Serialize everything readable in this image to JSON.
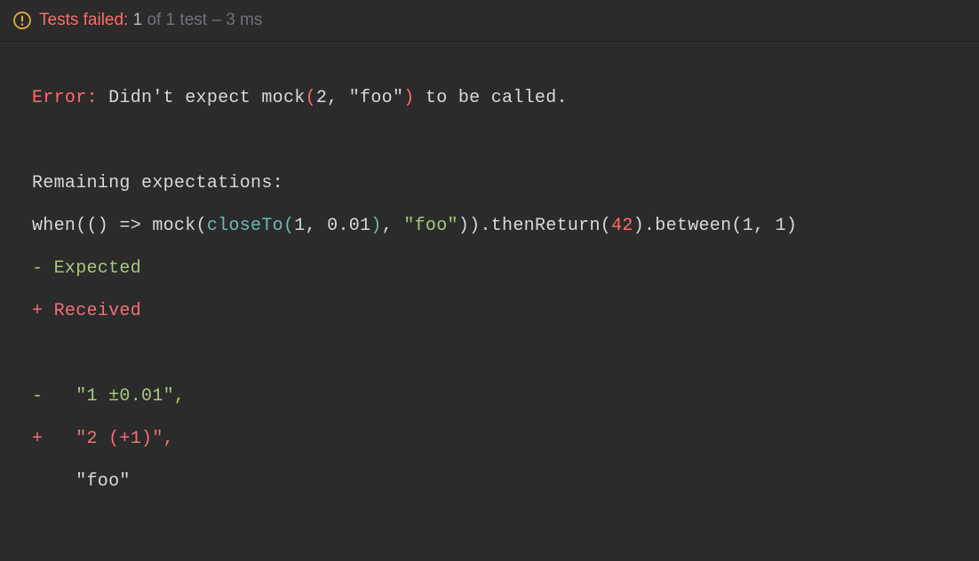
{
  "header": {
    "tests_failed_label": "Tests failed:",
    "failed_count": "1",
    "of_text": " of 1 test",
    "dash": " – ",
    "duration": "3 ms"
  },
  "output": {
    "error_label": "Error:",
    "error_prefix": " Didn't expect mock",
    "error_paren_open": "(",
    "error_args": "2, \"foo\"",
    "error_paren_close": ")",
    "error_suffix": " to be called.",
    "remaining_label": "Remaining expectations:",
    "when_text": "when(() => mock(",
    "closeTo_fn": "closeTo",
    "closeTo_open": "(",
    "closeTo_args": "1, 0.01",
    "closeTo_close": ")",
    "comma_foo": ", ",
    "foo_str": "\"foo\"",
    "after_mock_close": ")).thenReturn(",
    "return_val": "42",
    "after_return": ").between(",
    "between_args": "1, 1",
    "after_between": ")",
    "expected_line": "- Expected",
    "received_line": "+ Received",
    "diff_minus": "-   \"1 ±0.01\",",
    "diff_plus": "+   \"2 (+1)\",",
    "diff_same": "    \"foo\""
  }
}
